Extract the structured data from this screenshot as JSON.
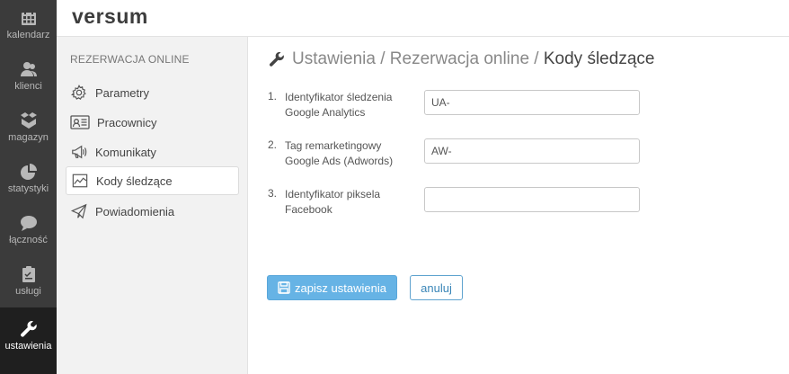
{
  "app": {
    "logo": "versum"
  },
  "nav": {
    "items": [
      {
        "label": "kalendarz",
        "icon": "calendar-icon"
      },
      {
        "label": "klienci",
        "icon": "users-icon"
      },
      {
        "label": "magazyn",
        "icon": "boxes-icon"
      },
      {
        "label": "statystyki",
        "icon": "pie-chart-icon"
      },
      {
        "label": "łączność",
        "icon": "chat-icon"
      },
      {
        "label": "usługi",
        "icon": "clipboard-icon"
      },
      {
        "label": "ustawienia",
        "icon": "wrench-icon",
        "active": true
      }
    ]
  },
  "subnav": {
    "title": "REZERWACJA ONLINE",
    "items": [
      {
        "label": "Parametry",
        "icon": "gear-icon"
      },
      {
        "label": "Pracownicy",
        "icon": "id-card-icon"
      },
      {
        "label": "Komunikaty",
        "icon": "megaphone-icon"
      },
      {
        "label": "Kody śledzące",
        "icon": "line-chart-icon",
        "active": true
      },
      {
        "label": "Powiadomienia",
        "icon": "paper-plane-icon"
      }
    ]
  },
  "breadcrumb": {
    "part1": "Ustawienia",
    "sep": " / ",
    "part2": "Rezerwacja online",
    "current": "Kody śledzące"
  },
  "form": {
    "fields": [
      {
        "num": "1.",
        "label_line1": "Identyfikator śledzenia",
        "label_line2": "Google Analytics",
        "value": "UA-"
      },
      {
        "num": "2.",
        "label_line1": "Tag remarketingowy",
        "label_line2": "Google Ads (Adwords)",
        "value": "AW-"
      },
      {
        "num": "3.",
        "label_line1": "Identyfikator piksela",
        "label_line2": "Facebook",
        "value": ""
      }
    ],
    "save_label": "zapisz ustawienia",
    "cancel_label": "anuluj"
  },
  "colors": {
    "nav_bg": "#3b3b3b",
    "nav_active_bg": "#1f1f1f",
    "subnav_bg": "#f2f2f2",
    "accent": "#66b3e5"
  }
}
